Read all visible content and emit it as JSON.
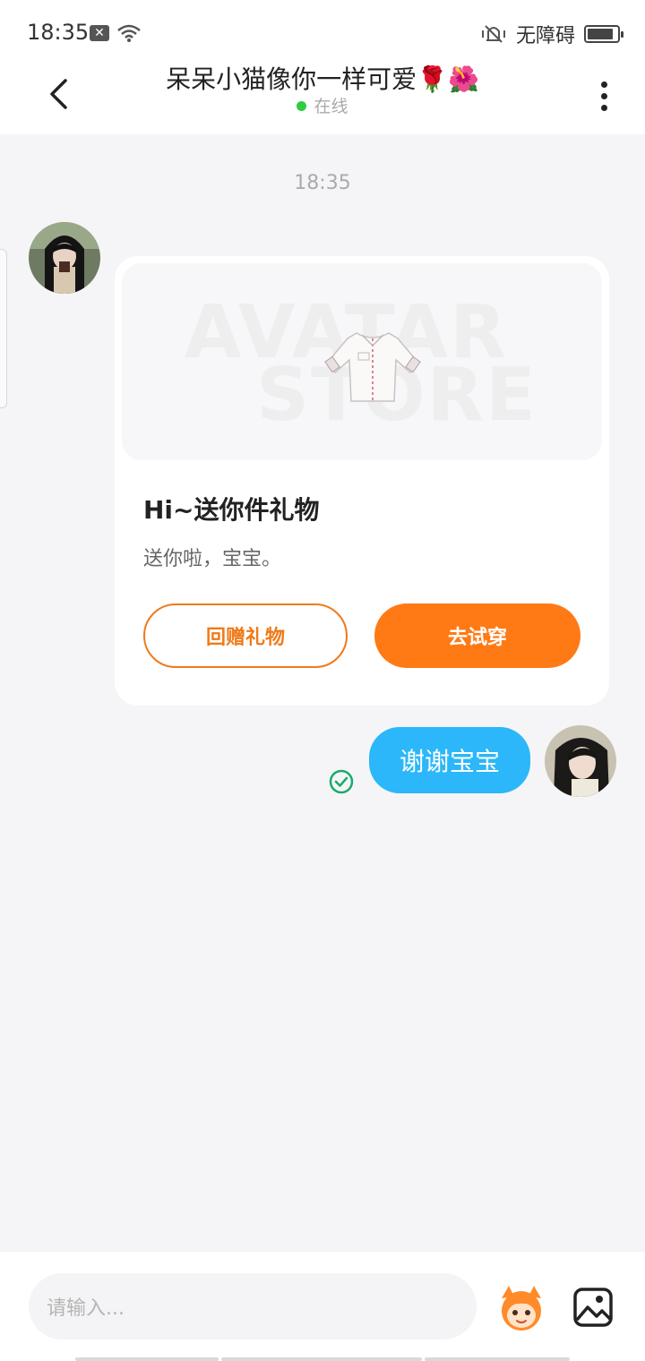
{
  "status_bar": {
    "time": "18:35",
    "sim_icon_glyph": "✕",
    "accessibility_label": "无障碍",
    "icons": [
      "sim-x-icon",
      "wifi-icon",
      "vibrate-icon",
      "battery-icon"
    ]
  },
  "header": {
    "title": "呆呆小猫像你一样可爱🌹🌺",
    "status": "在线",
    "status_color": "#2ecc40",
    "back_icon": "chevron-left-icon",
    "more_icon": "more-vertical-icon"
  },
  "chat": {
    "timestamp": "18:35",
    "gift_card": {
      "watermark_line1": "AVATAR",
      "watermark_line2": "STORE",
      "title": "Hi~送你件礼物",
      "description": "送你啦，宝宝。",
      "return_gift_label": "回赠礼物",
      "try_on_label": "去试穿",
      "accent_color": "#ff7a14"
    },
    "outgoing_message": {
      "text": "谢谢宝宝",
      "bubble_color": "#2bb7f9",
      "read_status_icon": "check-circle-icon"
    }
  },
  "input_bar": {
    "placeholder": "请输入...",
    "mascot_icon": "mascot-emoji-icon",
    "image_icon": "image-icon"
  }
}
